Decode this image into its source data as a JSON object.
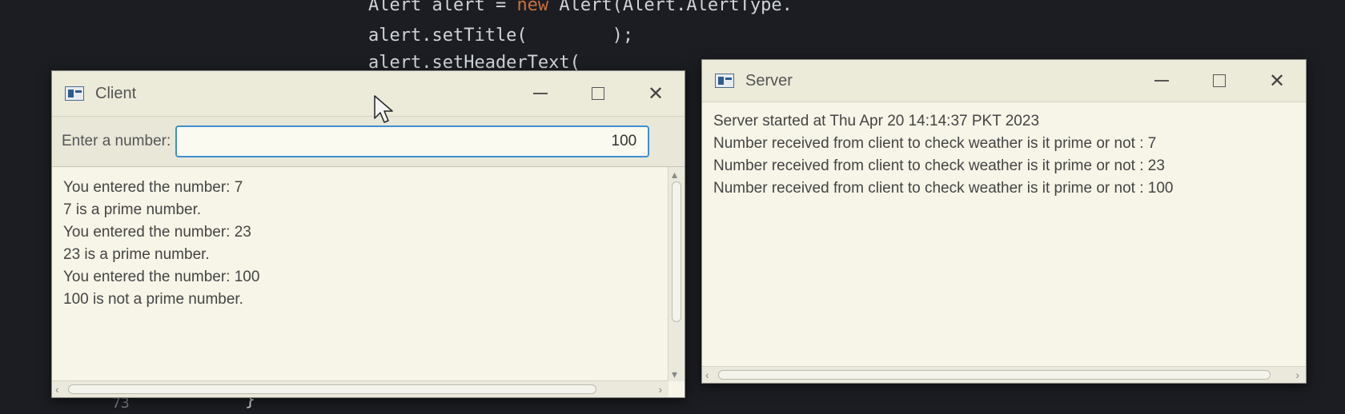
{
  "background_code": {
    "line1": {
      "a": "Alert alert = ",
      "kw": "new",
      "b": " Alert(Alert.AlertType."
    },
    "line2": "alert.setTitle(        );",
    "line3": "alert.setHeaderText(",
    "bottom_num": "73",
    "bottom_brace": "}"
  },
  "client": {
    "title": "Client",
    "input_label": "Enter a number:",
    "input_value": "100",
    "output_lines": [
      "You entered the number: 7",
      "7 is a prime number.",
      "You entered the number: 23",
      "23 is a prime number.",
      "You entered the number: 100",
      "100 is not a prime number."
    ]
  },
  "server": {
    "title": "Server",
    "log_lines": [
      "Server started at Thu Apr 20 14:14:37 PKT 2023",
      "Number received from client to check weather is it prime or not : 7",
      "Number received from client to check weather is it prime or not : 23",
      "Number received from client to check weather is it prime or not : 100"
    ]
  },
  "window_controls": {
    "minimize": "minimize-icon",
    "maximize": "maximize-icon",
    "close": "close-icon"
  },
  "colors": {
    "focus_border": "#3f8fcf",
    "window_bg": "#f3f1e3",
    "desktop_bg": "#1b1d22"
  }
}
